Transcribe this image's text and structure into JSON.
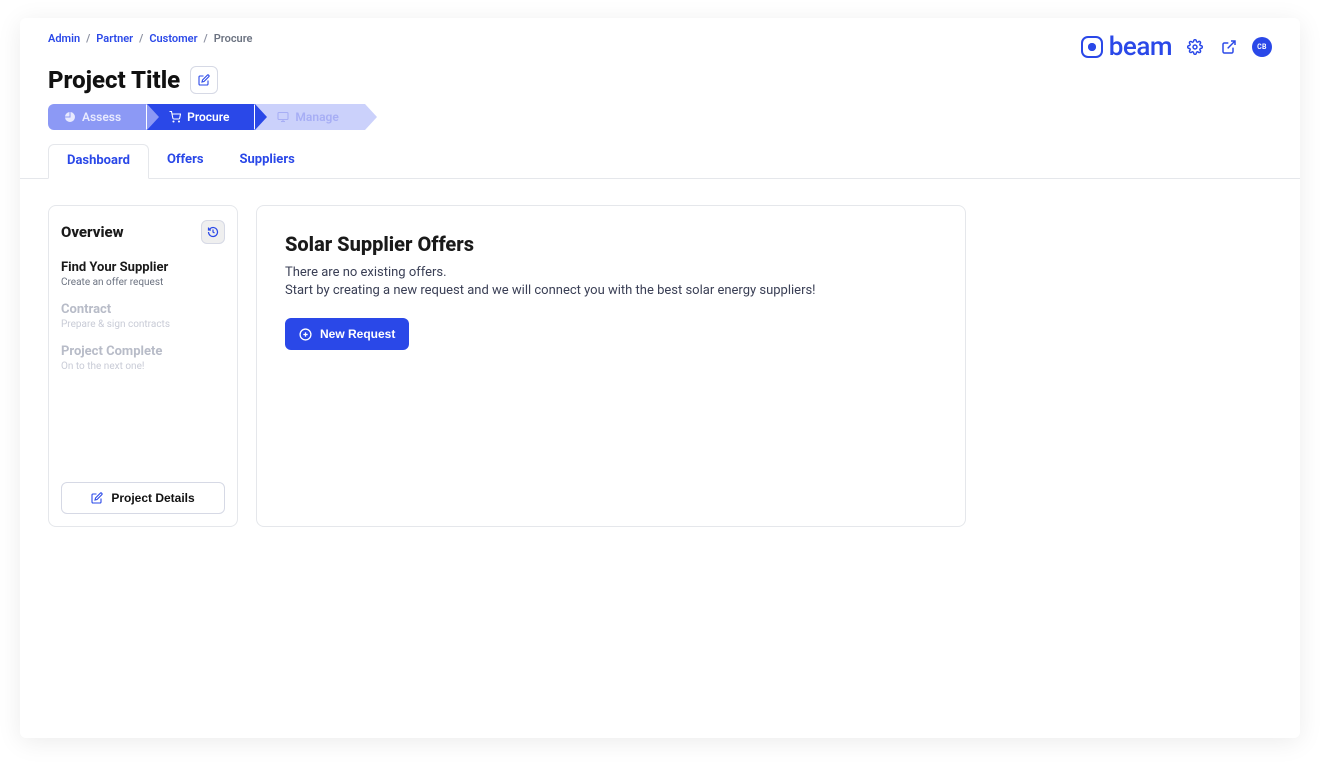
{
  "breadcrumb": {
    "items": [
      "Admin",
      "Partner",
      "Customer"
    ],
    "current": "Procure",
    "sep": "/"
  },
  "brand": {
    "name": "beam",
    "avatar_initials": "CB"
  },
  "page_title": "Project Title",
  "stepper": [
    {
      "label": "Assess",
      "state": "done"
    },
    {
      "label": "Procure",
      "state": "active"
    },
    {
      "label": "Manage",
      "state": "future"
    }
  ],
  "tabs": [
    {
      "label": "Dashboard",
      "active": true
    },
    {
      "label": "Offers",
      "active": false
    },
    {
      "label": "Suppliers",
      "active": false
    }
  ],
  "overview": {
    "title": "Overview",
    "steps": [
      {
        "title": "Find Your Supplier",
        "subtitle": "Create an offer request",
        "muted": false
      },
      {
        "title": "Contract",
        "subtitle": "Prepare & sign contracts",
        "muted": true
      },
      {
        "title": "Project Complete",
        "subtitle": "On to the next one!",
        "muted": true
      }
    ],
    "project_details_label": "Project Details"
  },
  "main": {
    "title": "Solar Supplier Offers",
    "empty_line1": "There are no existing offers.",
    "empty_line2": "Start by creating a new request and we will connect you with the best solar energy suppliers!",
    "new_request_label": "New Request"
  }
}
